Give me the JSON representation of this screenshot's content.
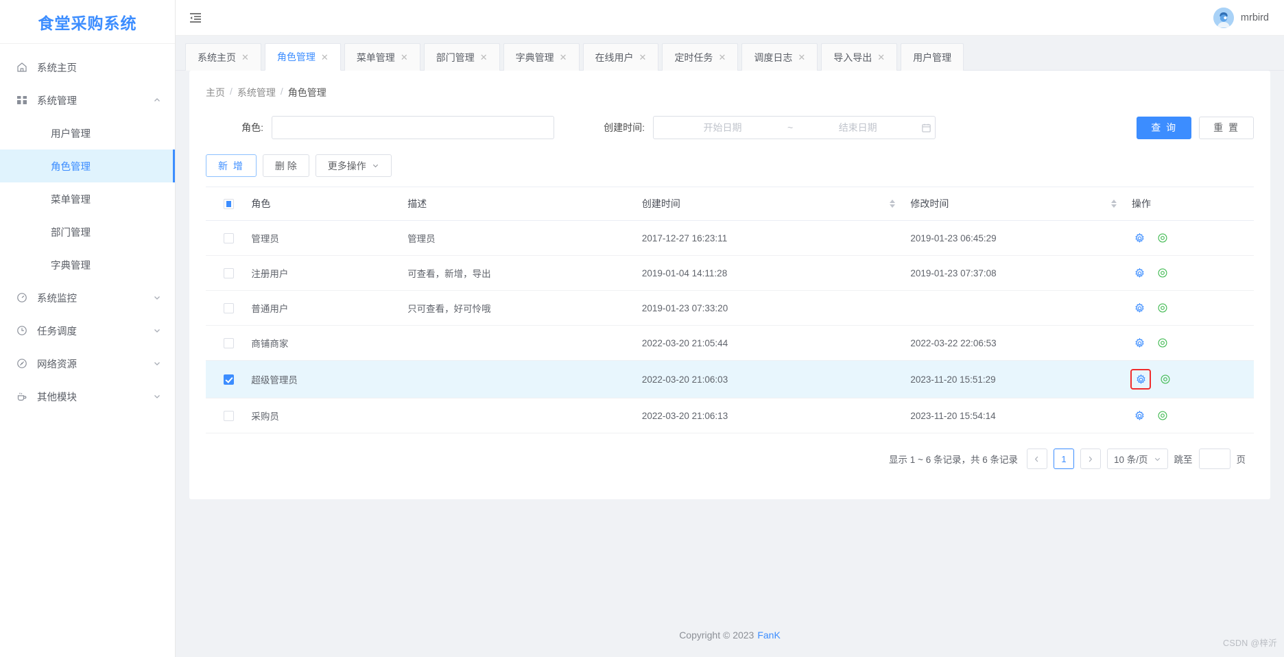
{
  "sidebar": {
    "logo": "食堂采购系统",
    "items": [
      {
        "label": "系统主页",
        "icon": "home-icon",
        "expandable": false
      },
      {
        "label": "系统管理",
        "icon": "grid-icon",
        "expandable": true,
        "expanded": true,
        "children": [
          {
            "label": "用户管理",
            "active": false
          },
          {
            "label": "角色管理",
            "active": true
          },
          {
            "label": "菜单管理",
            "active": false
          },
          {
            "label": "部门管理",
            "active": false
          },
          {
            "label": "字典管理",
            "active": false
          }
        ]
      },
      {
        "label": "系统监控",
        "icon": "gauge-icon",
        "expandable": true,
        "expanded": false
      },
      {
        "label": "任务调度",
        "icon": "clock-icon",
        "expandable": true,
        "expanded": false
      },
      {
        "label": "网络资源",
        "icon": "compass-icon",
        "expandable": true,
        "expanded": false
      },
      {
        "label": "其他模块",
        "icon": "cup-icon",
        "expandable": true,
        "expanded": false
      }
    ]
  },
  "topbar": {
    "collapse_icon": "menu-fold-icon",
    "username": "mrbird",
    "avatar_icon": "user-avatar-icon"
  },
  "tabs": [
    {
      "label": "系统主页",
      "active": false,
      "closable": true
    },
    {
      "label": "角色管理",
      "active": true,
      "closable": true
    },
    {
      "label": "菜单管理",
      "active": false,
      "closable": true
    },
    {
      "label": "部门管理",
      "active": false,
      "closable": true
    },
    {
      "label": "字典管理",
      "active": false,
      "closable": true
    },
    {
      "label": "在线用户",
      "active": false,
      "closable": true
    },
    {
      "label": "定时任务",
      "active": false,
      "closable": true
    },
    {
      "label": "调度日志",
      "active": false,
      "closable": true
    },
    {
      "label": "导入导出",
      "active": false,
      "closable": true
    },
    {
      "label": "用户管理",
      "active": false,
      "closable": true
    }
  ],
  "breadcrumb": [
    {
      "label": "主页"
    },
    {
      "label": "系统管理"
    },
    {
      "label": "角色管理"
    }
  ],
  "breadcrumb_separator": "/",
  "search": {
    "role_label": "角色:",
    "role_value": "",
    "role_placeholder": "",
    "time_label": "创建时间:",
    "start_placeholder": "开始日期",
    "end_placeholder": "结束日期",
    "start_value": "",
    "end_value": "",
    "range_separator": "~",
    "calendar_icon": "calendar-icon",
    "query_button": "查 询",
    "reset_button": "重 置"
  },
  "toolbar": {
    "add_button": "新 增",
    "delete_button": "删 除",
    "more_button": "更多操作",
    "more_caret": "chevron-down-icon"
  },
  "table": {
    "columns": [
      {
        "key": "check",
        "label": ""
      },
      {
        "key": "role",
        "label": "角色",
        "sortable": false
      },
      {
        "key": "desc",
        "label": "描述",
        "sortable": false
      },
      {
        "key": "ctime",
        "label": "创建时间",
        "sortable": true
      },
      {
        "key": "mtime",
        "label": "修改时间",
        "sortable": true
      },
      {
        "key": "ops",
        "label": "操作",
        "sortable": false
      }
    ],
    "header_checkbox_state": "indeterminate",
    "rows": [
      {
        "checked": false,
        "role": "管理员",
        "desc": "管理员",
        "ctime": "2017-12-27 16:23:11",
        "mtime": "2019-01-23 06:45:29",
        "ops": [
          "gear-icon",
          "eye-icon"
        ],
        "highlight_gear": false
      },
      {
        "checked": false,
        "role": "注册用户",
        "desc": "可查看，新增，导出",
        "ctime": "2019-01-04 14:11:28",
        "mtime": "2019-01-23 07:37:08",
        "ops": [
          "gear-icon",
          "eye-icon"
        ],
        "highlight_gear": false
      },
      {
        "checked": false,
        "role": "普通用户",
        "desc": "只可查看，好可怜哦",
        "ctime": "2019-01-23 07:33:20",
        "mtime": "",
        "ops": [
          "gear-icon",
          "eye-icon"
        ],
        "highlight_gear": false
      },
      {
        "checked": false,
        "role": "商铺商家",
        "desc": "",
        "ctime": "2022-03-20 21:05:44",
        "mtime": "2022-03-22 22:06:53",
        "ops": [
          "gear-icon",
          "eye-icon"
        ],
        "highlight_gear": false
      },
      {
        "checked": true,
        "role": "超级管理员",
        "desc": "",
        "ctime": "2022-03-20 21:06:03",
        "mtime": "2023-11-20 15:51:29",
        "ops": [
          "gear-icon",
          "eye-icon"
        ],
        "highlight_gear": true
      },
      {
        "checked": false,
        "role": "采购员",
        "desc": "",
        "ctime": "2022-03-20 21:06:13",
        "mtime": "2023-11-20 15:54:14",
        "ops": [
          "gear-icon",
          "eye-icon"
        ],
        "highlight_gear": false
      }
    ]
  },
  "pagination": {
    "total_text": "显示 1 ~ 6 条记录，共 6 条记录",
    "prev_icon": "chevron-left-icon",
    "next_icon": "chevron-right-icon",
    "current_page": "1",
    "page_size": "10 条/页",
    "page_size_caret": "chevron-down-icon",
    "jump_label": "跳至",
    "jump_value": "",
    "jump_unit": "页"
  },
  "footer": {
    "copyright": "Copyright © 2023",
    "brand": "FanK"
  },
  "watermark": "CSDN @梓沂",
  "colors": {
    "accent": "#3c8dff",
    "selected_row": "#e8f6fd",
    "sidebar_active_bg": "#e0f3fd",
    "gear_icon": "#3c8dff",
    "eye_icon": "#3fb950",
    "highlight_outline": "#f02b2b",
    "page_bg": "#f0f2f5"
  }
}
